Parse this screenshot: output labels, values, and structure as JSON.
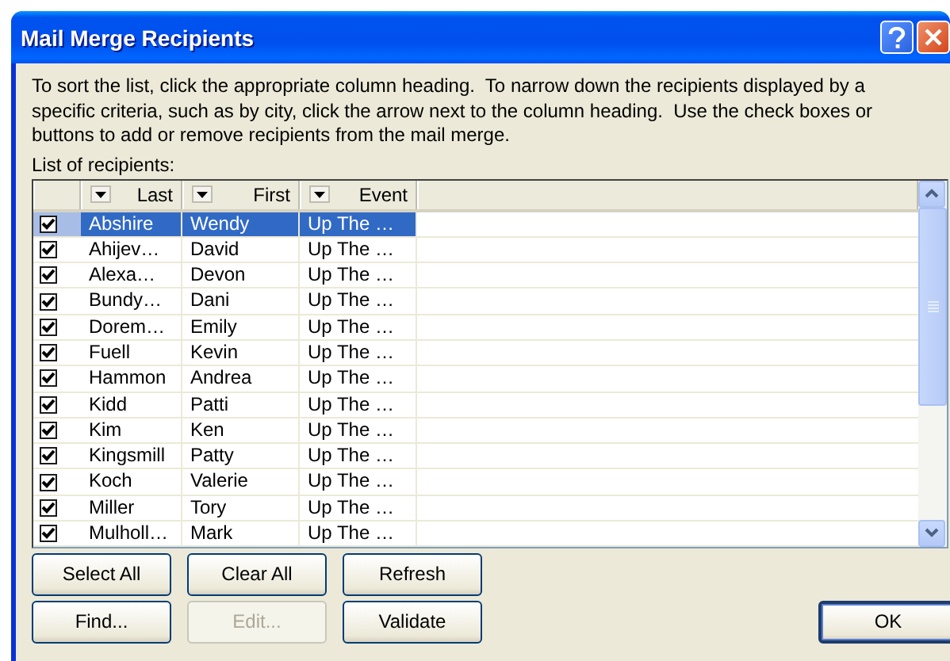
{
  "window": {
    "title": "Mail Merge Recipients"
  },
  "instructions": "To sort the list, click the appropriate column heading.  To narrow down the recipients displayed by a specific criteria, such as by city, click the arrow next to the column heading.  Use the check boxes or buttons to add or remove recipients from the mail merge.",
  "list_label": "List of recipients:",
  "table": {
    "columns": [
      "Last",
      "First",
      "Event"
    ],
    "rows": [
      {
        "checked": true,
        "selected": true,
        "cells": [
          "Abshire",
          "Wendy",
          "Up The …"
        ]
      },
      {
        "checked": true,
        "selected": false,
        "cells": [
          "Ahijev…",
          "David",
          "Up The …"
        ]
      },
      {
        "checked": true,
        "selected": false,
        "cells": [
          "Alexa…",
          "Devon",
          "Up The …"
        ]
      },
      {
        "checked": true,
        "selected": false,
        "cells": [
          "Bundy…",
          "Dani",
          "Up The …"
        ]
      },
      {
        "checked": true,
        "selected": false,
        "cells": [
          "Dorem…",
          "Emily",
          "Up The …"
        ]
      },
      {
        "checked": true,
        "selected": false,
        "cells": [
          "Fuell",
          "Kevin",
          "Up The …"
        ]
      },
      {
        "checked": true,
        "selected": false,
        "cells": [
          "Hammon",
          "Andrea",
          "Up The …"
        ]
      },
      {
        "checked": true,
        "selected": false,
        "cells": [
          "Kidd",
          "Patti",
          "Up The …"
        ]
      },
      {
        "checked": true,
        "selected": false,
        "cells": [
          "Kim",
          "Ken",
          "Up The …"
        ]
      },
      {
        "checked": true,
        "selected": false,
        "cells": [
          "Kingsmill",
          "Patty",
          "Up The …"
        ]
      },
      {
        "checked": true,
        "selected": false,
        "cells": [
          "Koch",
          "Valerie",
          "Up The …"
        ]
      },
      {
        "checked": true,
        "selected": false,
        "cells": [
          "Miller",
          "Tory",
          "Up The …"
        ]
      },
      {
        "checked": true,
        "selected": false,
        "cells": [
          "Mulholl…",
          "Mark",
          "Up The …"
        ]
      }
    ]
  },
  "button_rows": [
    [
      {
        "label": "Select All",
        "disabled": false
      },
      {
        "label": "Clear All",
        "disabled": false
      },
      {
        "label": "Refresh",
        "disabled": false
      }
    ],
    [
      {
        "label": "Find...",
        "disabled": false
      },
      {
        "label": "Edit...",
        "disabled": true
      },
      {
        "label": "Validate",
        "disabled": false
      }
    ]
  ],
  "ok_button": {
    "label": "OK"
  }
}
